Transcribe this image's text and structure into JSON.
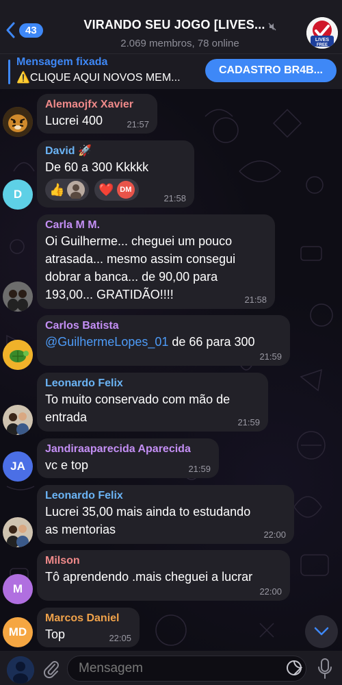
{
  "header": {
    "back_count": "43",
    "title": "VIRANDO SEU JOGO [LIVES...",
    "subtitle": "2.069 membros, 78 online",
    "group_avatar_text": "LIVES FREE"
  },
  "pinned": {
    "title": "Mensagem fixada",
    "text": "⚠️CLIQUE AQUI NOVOS MEM...",
    "button": "CADASTRO BR4B..."
  },
  "messages": [
    {
      "sender": "Alemaojfx Xavier",
      "sender_color": "#f08a8a",
      "text": "Lucrei 400",
      "time": "21:57",
      "avatar": "tiger-avatar"
    },
    {
      "sender": "David 🚀",
      "sender_color": "#6bb4f5",
      "text": "De 60 a 300 Kkkkk",
      "time": "21:58",
      "avatar_initials": "D",
      "avatar_color": "#5ed0e6",
      "reactions": [
        {
          "emoji": "👍",
          "reactor": "photo"
        },
        {
          "emoji": "❤️",
          "reactor": "DM"
        }
      ]
    },
    {
      "sender": "Carla M M.",
      "sender_color": "#c48ff5",
      "lines": [
        "Oi Guilherme... cheguei um pouco",
        "atrasada... mesmo assim consegui",
        "dobrar a banca... de 90,00 para",
        "193,00... GRATIDÃO!!!!"
      ],
      "time": "21:58"
    },
    {
      "sender": "Carlos Batista",
      "sender_color": "#c48ff5",
      "mention": "@GuilhermeLopes_01",
      "text": " de 66 para 300",
      "time": "21:59"
    },
    {
      "sender": "Leonardo Felix",
      "sender_color": "#6bb4f5",
      "lines": [
        "To muito conservado com mão de",
        "entrada"
      ],
      "time": "21:59"
    },
    {
      "sender": "Jandiraaparecida Aparecida",
      "sender_color": "#c48ff5",
      "text": "vc e top",
      "time": "21:59",
      "avatar_initials": "JA",
      "avatar_color": "#4b6fe6"
    },
    {
      "sender": "Leonardo Felix",
      "sender_color": "#6bb4f5",
      "lines": [
        "Lucrei 35,00 mais ainda to estudando",
        "as mentorias"
      ],
      "time": "22:00"
    },
    {
      "sender": "Milson",
      "sender_color": "#f08a8a",
      "text": "Tô aprendendo .mais cheguei a lucrar",
      "time": "22:00",
      "avatar_initials": "M",
      "avatar_color": "#b06fe0"
    },
    {
      "sender": "Marcos Daniel",
      "sender_color": "#f0a24a",
      "text": "Top",
      "time": "22:05",
      "avatar_initials": "MD",
      "avatar_color": "#f5a642"
    }
  ],
  "composer": {
    "placeholder": "Mensagem"
  },
  "colors": {
    "accent": "#3e88f7",
    "bubble": "#222128",
    "header_bg": "#1c1b22"
  }
}
